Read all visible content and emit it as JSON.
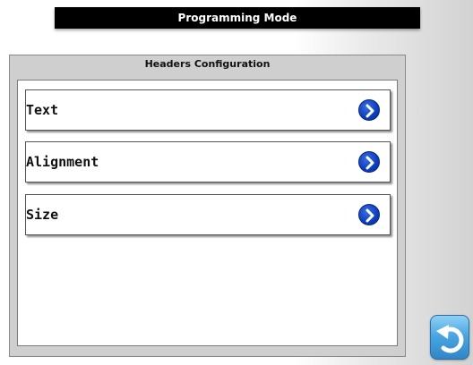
{
  "header": {
    "title": "Programming Mode"
  },
  "panel": {
    "title": "Headers Configuration",
    "items": [
      {
        "label": "Text",
        "icon": "chevron-right-icon"
      },
      {
        "label": "Alignment",
        "icon": "chevron-right-icon"
      },
      {
        "label": "Size",
        "icon": "chevron-right-icon"
      }
    ]
  },
  "footer": {
    "back_icon": "back-arrow-icon"
  },
  "colors": {
    "title_bar": "#000000",
    "chevron": "#0b3cc2",
    "back_button": "#4aa7e3"
  }
}
